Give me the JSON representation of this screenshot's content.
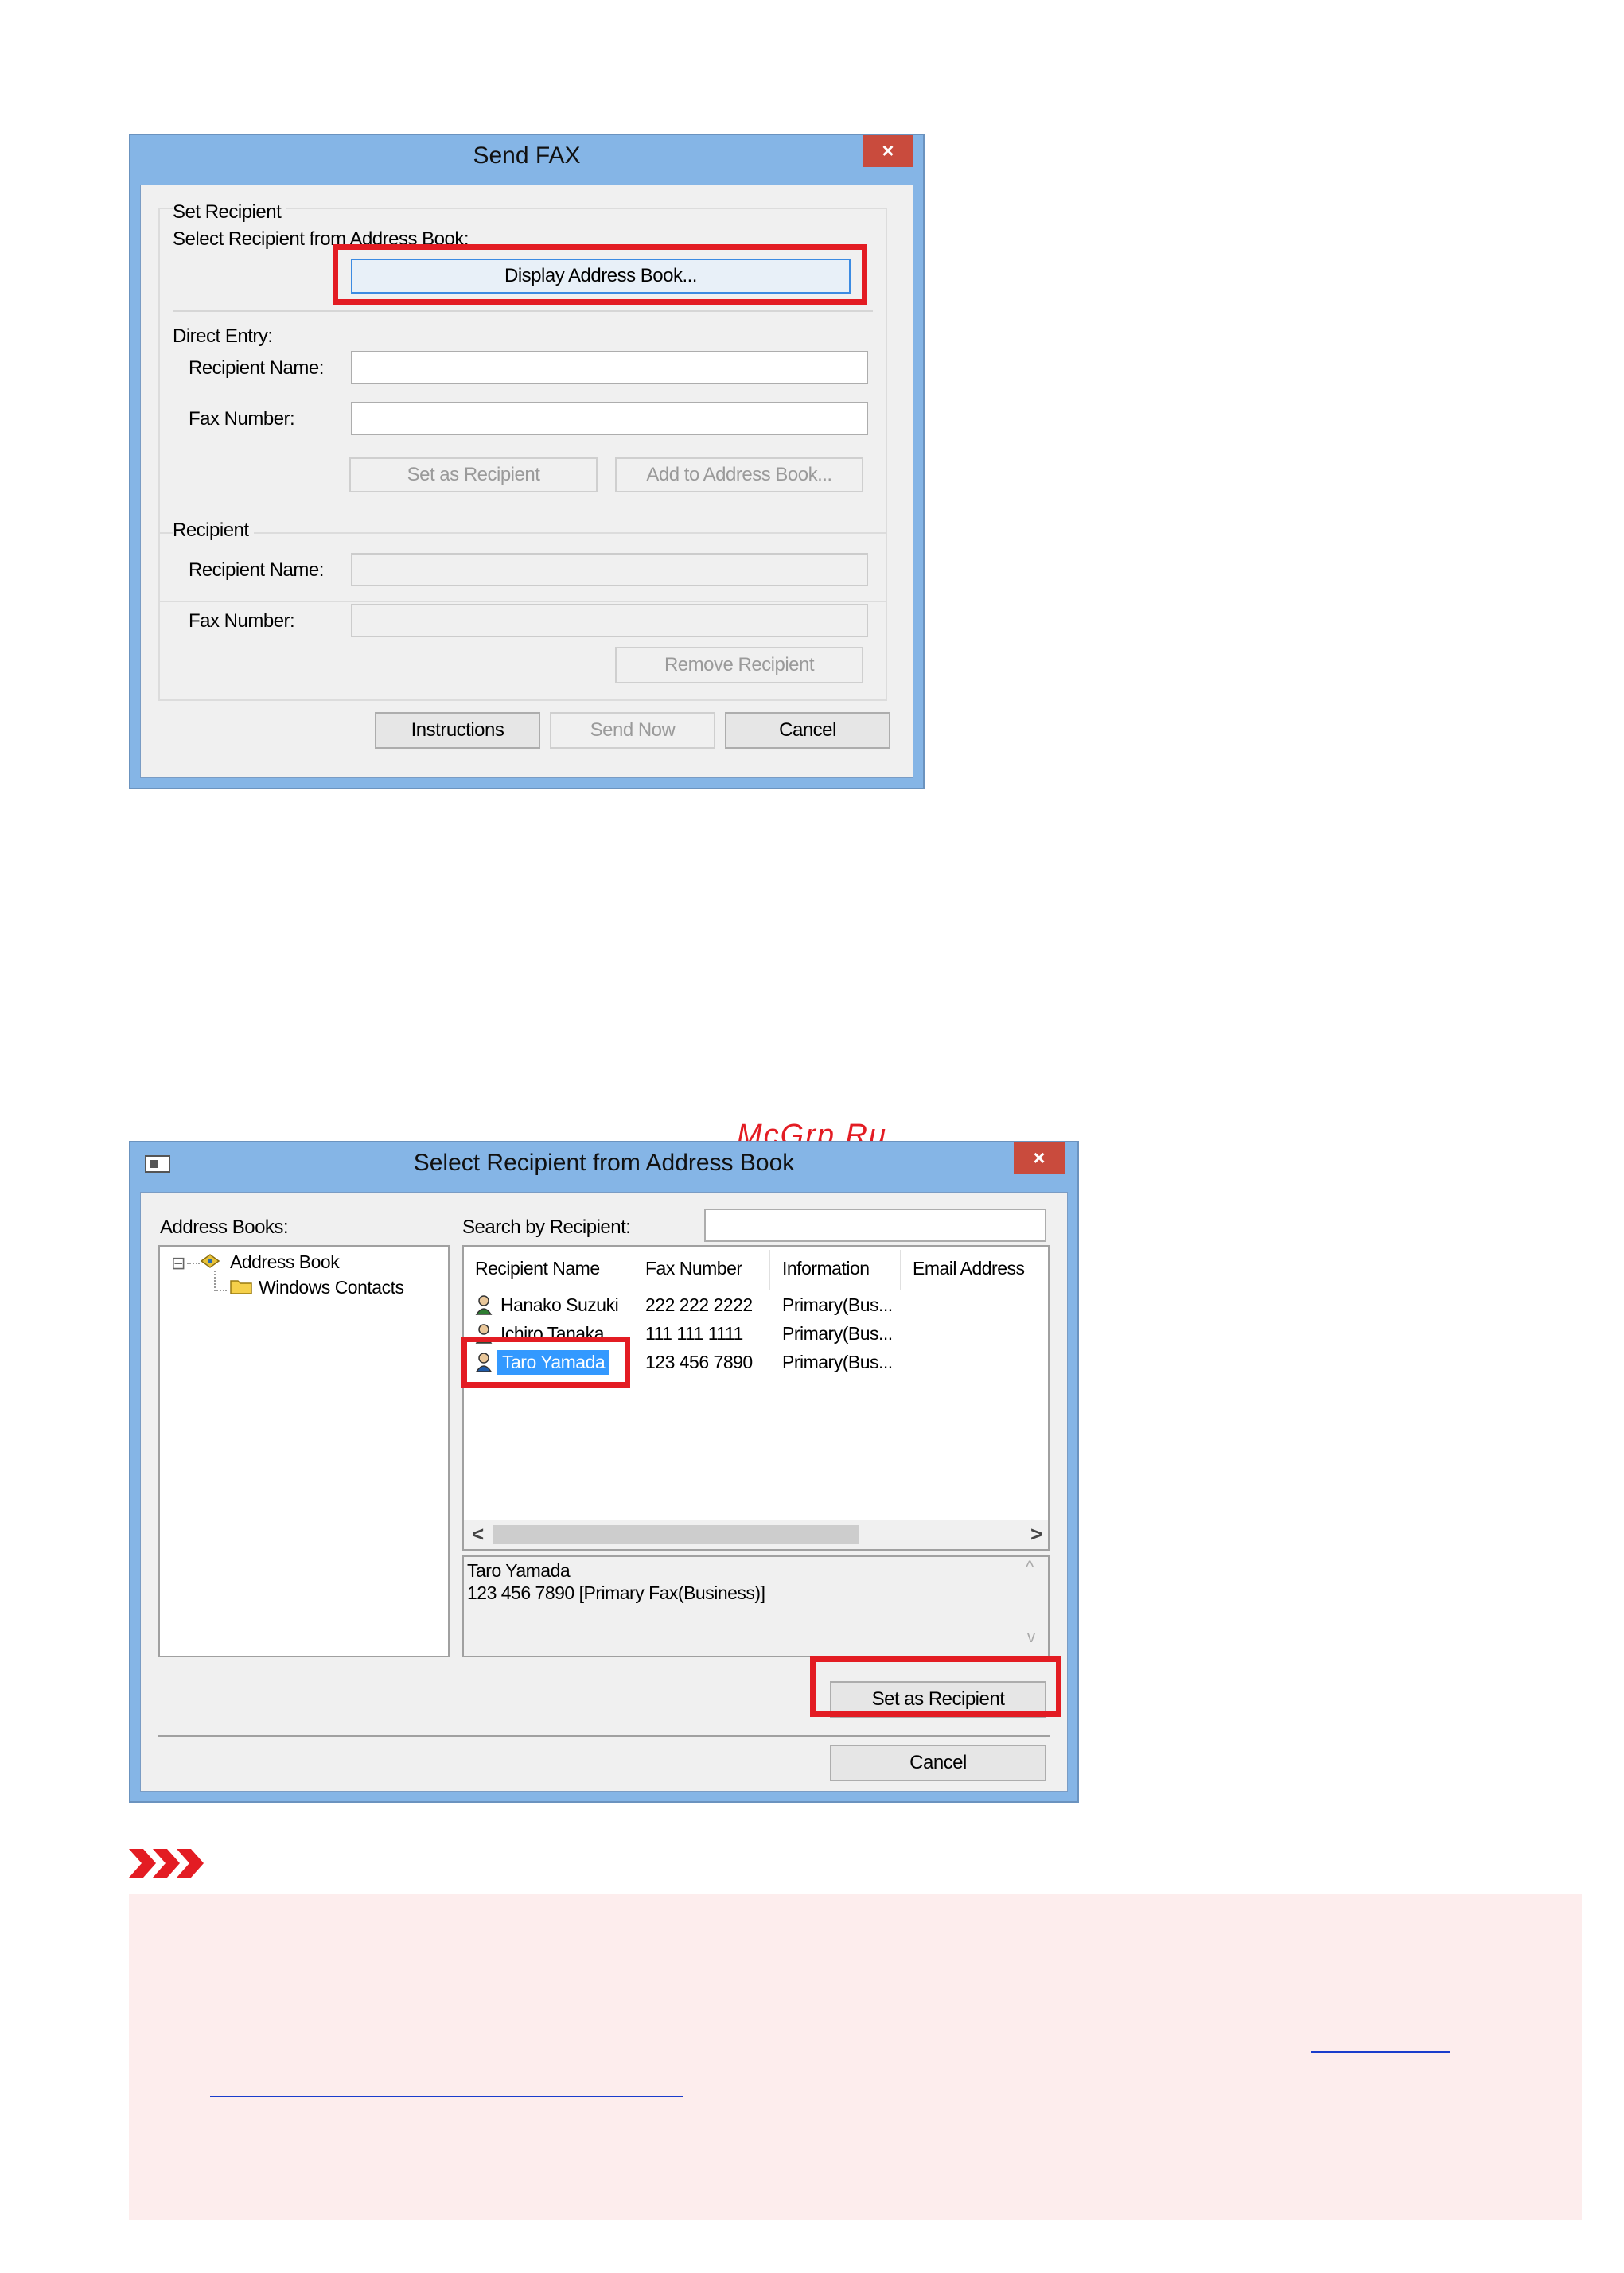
{
  "send_fax": {
    "title": "Send FAX",
    "close_symbol": "×",
    "set_recipient_label": "Set Recipient",
    "select_from_ab_label": "Select Recipient from Address Book:",
    "display_ab_button": "Display Address Book...",
    "direct_entry_label": "Direct Entry:",
    "recipient_name_label": "Recipient Name:",
    "recipient_name_value": "",
    "fax_number_label": "Fax Number:",
    "fax_number_value": "",
    "set_as_recipient_button": "Set as Recipient",
    "add_to_ab_button": "Add to Address Book...",
    "recipient_group_label": "Recipient",
    "recipient_name_label2": "Recipient Name:",
    "fax_number_label2": "Fax Number:",
    "remove_recipient_button": "Remove Recipient",
    "instructions_button": "Instructions",
    "send_now_button": "Send Now",
    "cancel_button": "Cancel"
  },
  "watermark": "McGrp.Ru",
  "address_book": {
    "title": "Select Recipient from Address Book",
    "close_symbol": "×",
    "address_books_label": "Address Books:",
    "tree": {
      "expander": "⊟",
      "root": "Address Book",
      "child": "Windows Contacts"
    },
    "search_label": "Search by Recipient:",
    "search_value": "",
    "columns": [
      "Recipient Name",
      "Fax Number",
      "Information",
      "Email Address"
    ],
    "rows": [
      {
        "name": "Hanako Suzuki",
        "fax": "222 222 2222",
        "info": "Primary(Bus...",
        "email": ""
      },
      {
        "name": "Ichiro Tanaka",
        "fax": "111 111 1111",
        "info": "Primary(Bus...",
        "email": ""
      },
      {
        "name": "Taro Yamada",
        "fax": "123 456 7890",
        "info": "Primary(Bus...",
        "email": ""
      }
    ],
    "scroll_left": "<",
    "scroll_right": ">",
    "detail_line1": "Taro Yamada",
    "detail_line2": "123 456 7890 [Primary Fax(Business)]",
    "detail_up": "^",
    "detail_down": "v",
    "set_as_recipient_button": "Set as Recipient",
    "cancel_button": "Cancel"
  },
  "note": {
    "important_icon": "important-chevrons-icon",
    "link_text_line1": "",
    "link_text_line2": ""
  },
  "colors": {
    "highlight": "#e31c23",
    "window_frame": "#85b5e6",
    "close_button": "#c94b3d",
    "selection": "#3399ff",
    "note_background": "#fdeded"
  }
}
